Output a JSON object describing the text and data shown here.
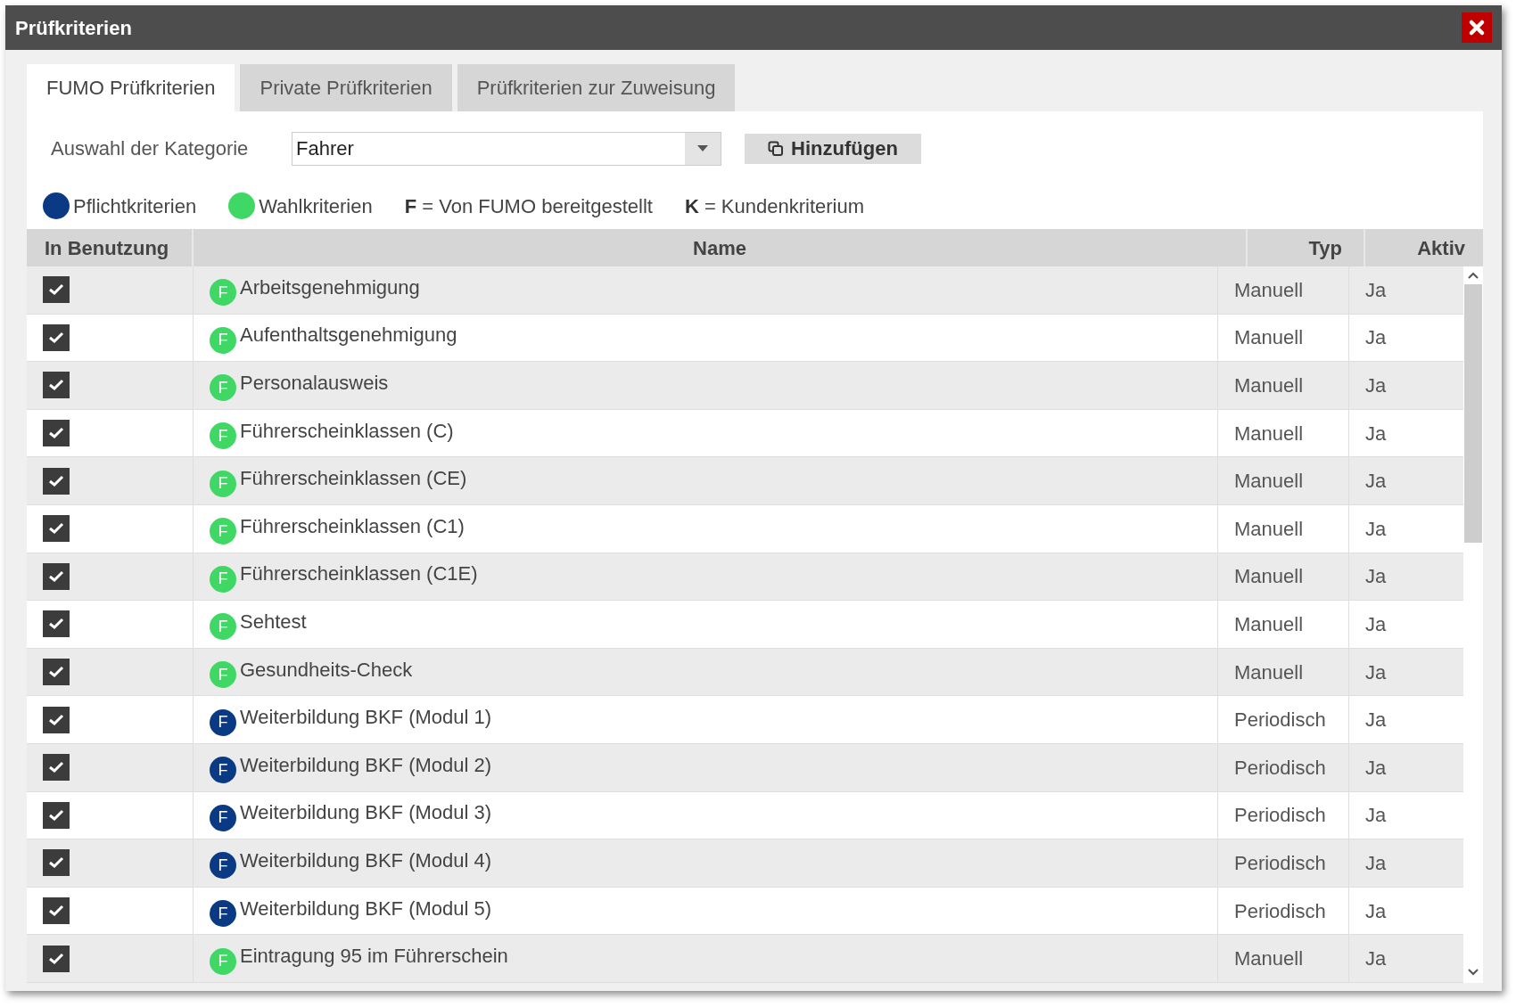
{
  "window": {
    "title": "Prüfkriterien"
  },
  "tabs": [
    {
      "label": "FUMO Prüfkriterien",
      "selected": true
    },
    {
      "label": "Private Prüfkriterien",
      "selected": false
    },
    {
      "label": "Prüfkriterien zur Zuweisung",
      "selected": false
    }
  ],
  "category": {
    "label": "Auswahl der Kategorie",
    "value": "Fahrer"
  },
  "add_button": "Hinzufügen",
  "legend": [
    {
      "kind": "dot",
      "label": "Pflichtkriterien",
      "color": "#0b3a85"
    },
    {
      "kind": "dot",
      "label": "Wahlkriterien",
      "color": "#3fd865"
    },
    {
      "kind": "key",
      "key": "F",
      "label": "= Von FUMO bereitgestellt"
    },
    {
      "kind": "key",
      "key": "K",
      "label": "= Kundenkriterium"
    }
  ],
  "table": {
    "columns": [
      "In Benutzung",
      "Name",
      "Typ",
      "Aktiv"
    ],
    "rows": [
      {
        "checked": true,
        "badge": "F",
        "color": "#3fd865",
        "name": "Arbeitsgenehmigung",
        "typ": "Manuell",
        "aktiv": "Ja"
      },
      {
        "checked": true,
        "badge": "F",
        "color": "#3fd865",
        "name": "Aufenthaltsgenehmigung",
        "typ": "Manuell",
        "aktiv": "Ja"
      },
      {
        "checked": true,
        "badge": "F",
        "color": "#3fd865",
        "name": "Personalausweis",
        "typ": "Manuell",
        "aktiv": "Ja"
      },
      {
        "checked": true,
        "badge": "F",
        "color": "#3fd865",
        "name": "Führerscheinklassen (C)",
        "typ": "Manuell",
        "aktiv": "Ja"
      },
      {
        "checked": true,
        "badge": "F",
        "color": "#3fd865",
        "name": "Führerscheinklassen (CE)",
        "typ": "Manuell",
        "aktiv": "Ja"
      },
      {
        "checked": true,
        "badge": "F",
        "color": "#3fd865",
        "name": "Führerscheinklassen (C1)",
        "typ": "Manuell",
        "aktiv": "Ja"
      },
      {
        "checked": true,
        "badge": "F",
        "color": "#3fd865",
        "name": "Führerscheinklassen (C1E)",
        "typ": "Manuell",
        "aktiv": "Ja"
      },
      {
        "checked": true,
        "badge": "F",
        "color": "#3fd865",
        "name": "Sehtest",
        "typ": "Manuell",
        "aktiv": "Ja"
      },
      {
        "checked": true,
        "badge": "F",
        "color": "#3fd865",
        "name": "Gesundheits-Check",
        "typ": "Manuell",
        "aktiv": "Ja"
      },
      {
        "checked": true,
        "badge": "F",
        "color": "#0b3a85",
        "name": "Weiterbildung BKF (Modul 1)",
        "typ": "Periodisch",
        "aktiv": "Ja"
      },
      {
        "checked": true,
        "badge": "F",
        "color": "#0b3a85",
        "name": "Weiterbildung BKF (Modul 2)",
        "typ": "Periodisch",
        "aktiv": "Ja"
      },
      {
        "checked": true,
        "badge": "F",
        "color": "#0b3a85",
        "name": "Weiterbildung BKF (Modul 3)",
        "typ": "Periodisch",
        "aktiv": "Ja"
      },
      {
        "checked": true,
        "badge": "F",
        "color": "#0b3a85",
        "name": "Weiterbildung BKF (Modul 4)",
        "typ": "Periodisch",
        "aktiv": "Ja"
      },
      {
        "checked": true,
        "badge": "F",
        "color": "#0b3a85",
        "name": "Weiterbildung BKF (Modul 5)",
        "typ": "Periodisch",
        "aktiv": "Ja"
      },
      {
        "checked": true,
        "badge": "F",
        "color": "#3fd865",
        "name": "Eintragung 95 im Führerschein",
        "typ": "Manuell",
        "aktiv": "Ja"
      }
    ]
  }
}
